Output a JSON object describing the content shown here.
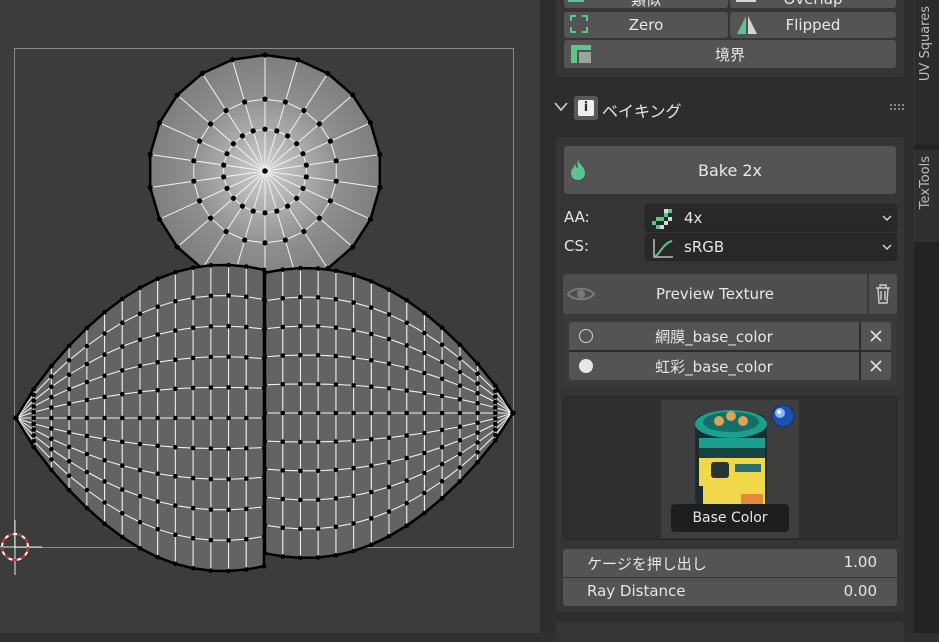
{
  "stretch_section": {
    "row1": [
      "類似",
      "Overlap"
    ],
    "row2": [
      "Zero",
      "Flipped"
    ],
    "row3": "境界"
  },
  "bake_section": {
    "title": "ベイキング",
    "bake_button": "Bake 2x",
    "aa_label": "AA:",
    "aa_value": "4x",
    "cs_label": "CS:",
    "cs_value": "sRGB",
    "preview_button": "Preview Texture",
    "textures": [
      {
        "name": "網膜_base_color",
        "selected": false
      },
      {
        "name": "虹彩_base_color",
        "selected": true
      }
    ],
    "thumbnail_caption": "Base Color",
    "cage_extrusion_label": "ケージを押し出し",
    "cage_extrusion_value": "1.00",
    "ray_distance_label": "Ray Distance",
    "ray_distance_value": "0.00"
  },
  "side_tabs": [
    "UV Squares",
    "TexTools"
  ],
  "colors": {
    "accent_green": "#5cc48c",
    "viewport_bg": "#3c3c3c",
    "panel_bg": "#2d2d2d",
    "button_bg": "#545454"
  }
}
